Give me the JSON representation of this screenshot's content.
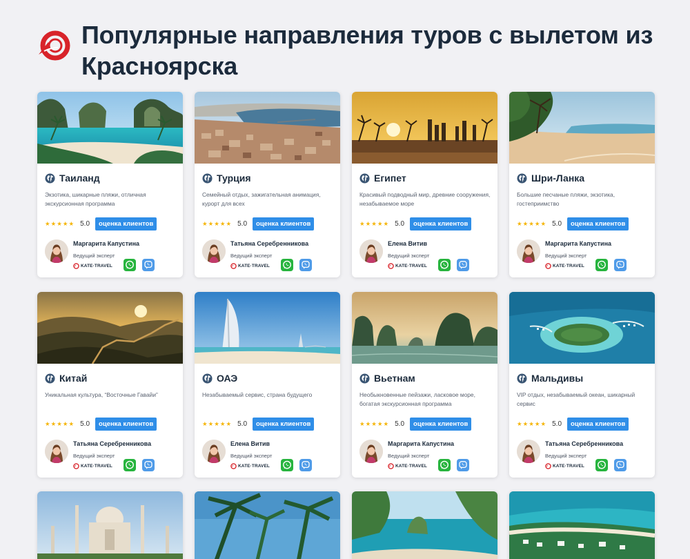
{
  "page": {
    "title": "Популярные направления туров с вылетом из Красноярска"
  },
  "colors": {
    "accent": "#2f8ee8",
    "brand": "#d8232a",
    "whatsapp": "#27b43e",
    "viber": "#4f9be8",
    "stars": "#f5b50a"
  },
  "cards": [
    {
      "country": "Таиланд",
      "desc": "Экзотика, шикарные пляжи, отличная экскурсионная программа",
      "stars": "★★★★★",
      "score": "5.0",
      "badge": "оценка клиентов",
      "expert": "Маргарита Капустина",
      "role": "Ведущий эксперт",
      "brand": "KATE·TRAVEL"
    },
    {
      "country": "Турция",
      "desc": "Семейный отдых, зажигательная анимация, курорт для всех",
      "stars": "★★★★★",
      "score": "5.0",
      "badge": "оценка клиентов",
      "expert": "Татьяна Серебренникова",
      "role": "Ведущий эксперт",
      "brand": "KATE·TRAVEL"
    },
    {
      "country": "Египет",
      "desc": "Красивый подводный мир, древние сооружения, незабываемое море",
      "stars": "★★★★★",
      "score": "5.0",
      "badge": "оценка клиентов",
      "expert": "Елена Витив",
      "role": "Ведущий эксперт",
      "brand": "KATE·TRAVEL"
    },
    {
      "country": "Шри-Ланка",
      "desc": "Большие песчаные пляжи, экзотика, гостеприимство",
      "stars": "★★★★★",
      "score": "5.0",
      "badge": "оценка клиентов",
      "expert": "Маргарита Капустина",
      "role": "Ведущий эксперт",
      "brand": "KATE·TRAVEL"
    },
    {
      "country": "Китай",
      "desc": "Уникальная культура, “Восточные Гавайи”",
      "stars": "★★★★★",
      "score": "5.0",
      "badge": "оценка клиентов",
      "expert": "Татьяна Серебренникова",
      "role": "Ведущий эксперт",
      "brand": "KATE·TRAVEL"
    },
    {
      "country": "ОАЭ",
      "desc": "Незабываемый сервис, страна будущего",
      "stars": "★★★★★",
      "score": "5.0",
      "badge": "оценка клиентов",
      "expert": "Елена Витив",
      "role": "Ведущий эксперт",
      "brand": "KATE·TRAVEL"
    },
    {
      "country": "Вьетнам",
      "desc": "Необыкновенные пейзажи, ласковое море, богатая экскурсионная программа",
      "stars": "★★★★★",
      "score": "5.0",
      "badge": "оценка клиентов",
      "expert": "Маргарита Капустина",
      "role": "Ведущий эксперт",
      "brand": "KATE·TRAVEL"
    },
    {
      "country": "Мальдивы",
      "desc": "VIP отдых, незабываемый океан, шикарный сервис",
      "stars": "★★★★★",
      "score": "5.0",
      "badge": "оценка клиентов",
      "expert": "Татьяна Серебренникова",
      "role": "Ведущий эксперт",
      "brand": "KATE·TRAVEL"
    }
  ],
  "icons": {
    "logo": "kate-travel-logo-icon",
    "country": "globe-icon",
    "whatsapp": "whatsapp-icon",
    "viber": "viber-icon"
  }
}
